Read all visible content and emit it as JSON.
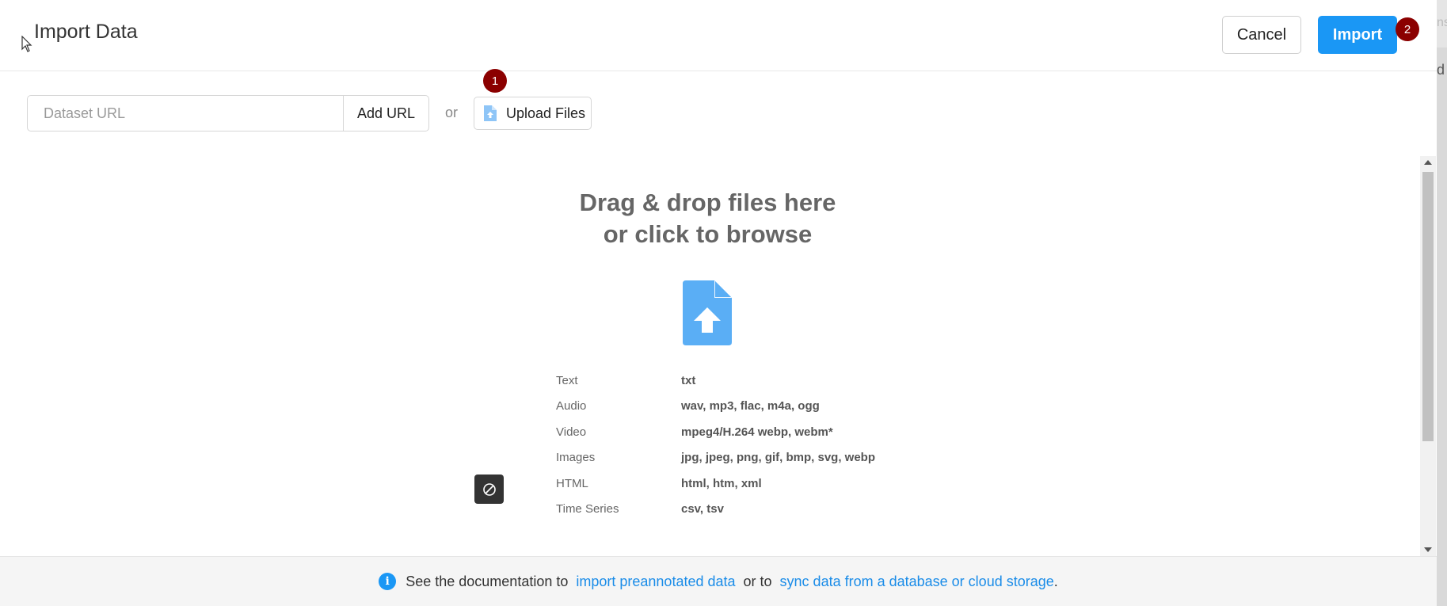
{
  "header": {
    "title": "Import Data",
    "cancel_label": "Cancel",
    "import_label": "Import",
    "import_badge": "2"
  },
  "url_row": {
    "placeholder": "Dataset URL",
    "add_url_label": "Add URL",
    "or_text": "or",
    "upload_label": "Upload Files",
    "upload_badge": "1"
  },
  "dropzone": {
    "line1": "Drag & drop files here",
    "line2": "or click to browse",
    "icon": "file-upload-icon",
    "formats": [
      {
        "type": "Text",
        "ext": "txt"
      },
      {
        "type": "Audio",
        "ext": "wav, mp3, flac, m4a, ogg"
      },
      {
        "type": "Video",
        "ext": "mpeg4/H.264 webp, webm*"
      },
      {
        "type": "Images",
        "ext": "jpg, jpeg, png, gif, bmp, svg, webp"
      },
      {
        "type": "HTML",
        "ext": "html, htm, xml"
      },
      {
        "type": "Time Series",
        "ext": "csv, tsv"
      }
    ]
  },
  "footer": {
    "prefix": "See the documentation to",
    "link1": "import preannotated data",
    "middle": "or to",
    "link2": "sync data from a database or cloud storage",
    "suffix": "."
  },
  "edge": {
    "frag1": "ns",
    "frag2": "d"
  },
  "colors": {
    "primary": "#1a97f5",
    "badge": "#8b0000",
    "link": "#1a8ce8"
  }
}
